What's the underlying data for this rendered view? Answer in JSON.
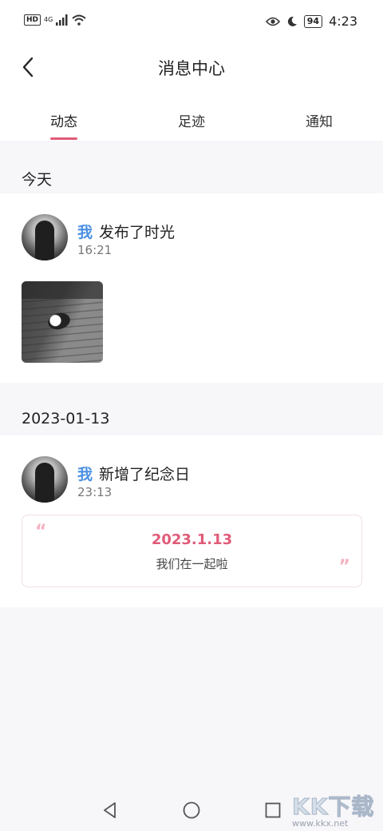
{
  "status_bar": {
    "network_badge": "HD",
    "network_type": "4G",
    "battery": "94",
    "time": "4:23"
  },
  "header": {
    "title": "消息中心"
  },
  "tabs": [
    {
      "label": "动态",
      "active": true
    },
    {
      "label": "足迹",
      "active": false
    },
    {
      "label": "通知",
      "active": false
    }
  ],
  "sections": [
    {
      "date_label": "今天",
      "item": {
        "user": "我",
        "action": "发布了时光",
        "time": "16:21"
      }
    },
    {
      "date_label": "2023-01-13",
      "item": {
        "user": "我",
        "action": "新增了纪念日",
        "time": "23:13",
        "anniversary_date": "2023.1.13",
        "anniversary_text": "我们在一起啦"
      }
    }
  ],
  "watermark": {
    "brand": "KK下载",
    "url": "www.kkx.net"
  },
  "colors": {
    "accent": "#e05b78",
    "user_blue": "#4a90e2",
    "background": "#f7f6f9"
  }
}
